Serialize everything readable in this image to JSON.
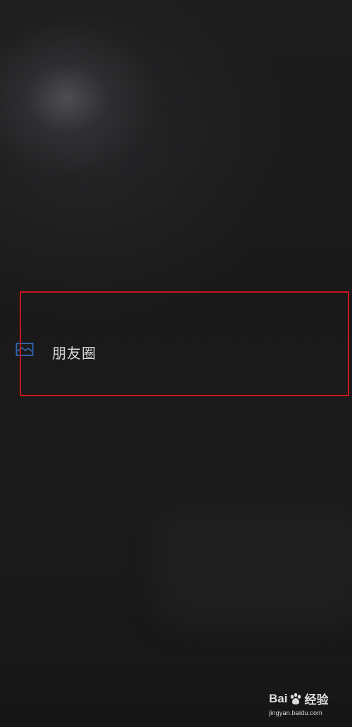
{
  "menu": {
    "items": [
      {
        "label": "朋友圈",
        "icon": "moments-image-icon",
        "icon_color": "#2f63a8"
      }
    ]
  },
  "highlight": {
    "color": "#c8161d"
  },
  "watermark": {
    "logo_left": "Bai",
    "logo_right": "经验",
    "url": "jingyan.baidu.com"
  }
}
